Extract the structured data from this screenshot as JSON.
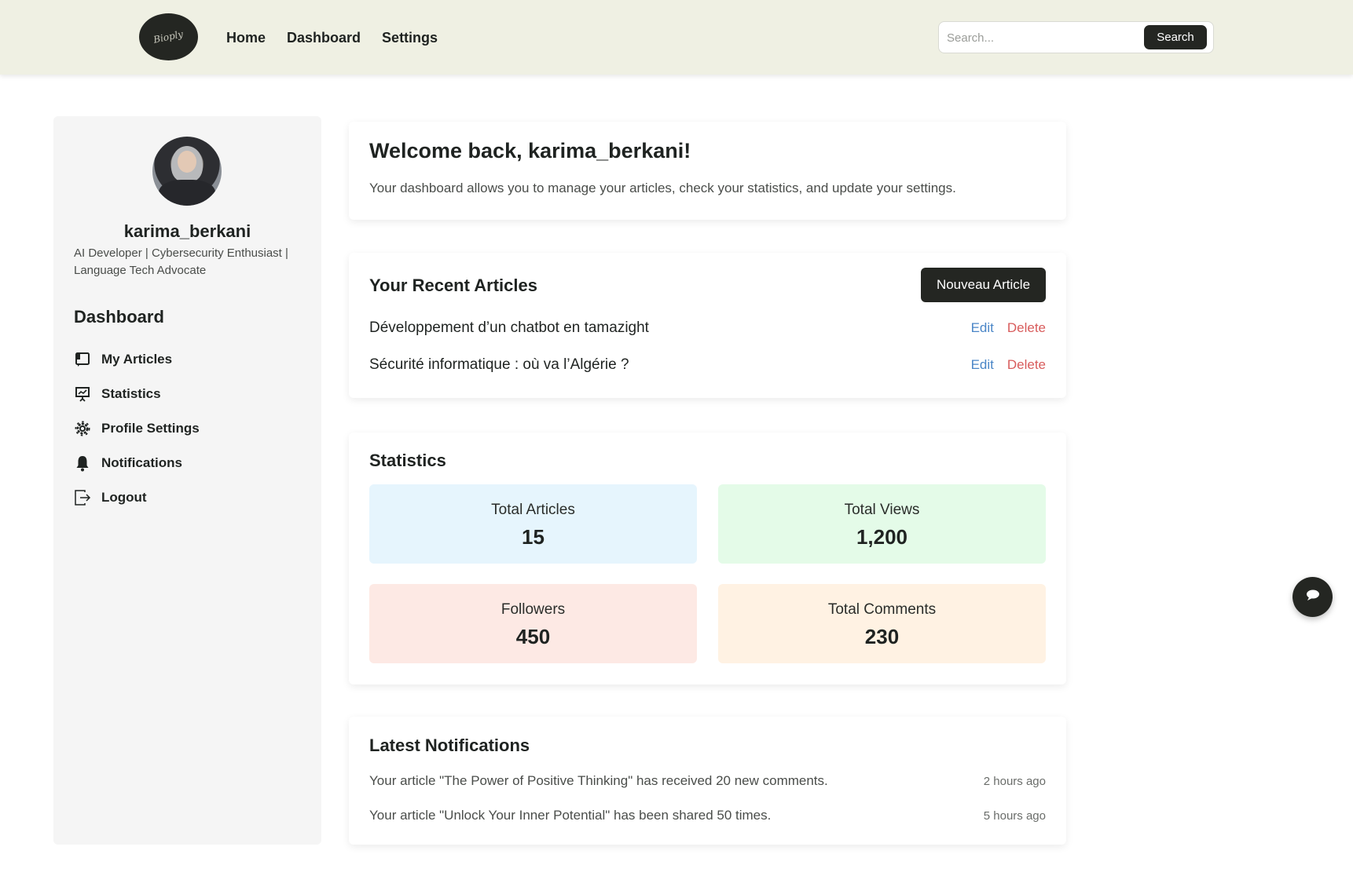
{
  "header": {
    "logo_text": "Bioply",
    "nav": [
      {
        "label": "Home"
      },
      {
        "label": "Dashboard"
      },
      {
        "label": "Settings"
      }
    ],
    "search": {
      "placeholder": "Search...",
      "button_label": "Search"
    }
  },
  "sidebar": {
    "username": "karima_berkani",
    "bio": "AI Developer | Cybersecurity Enthusiast | Language Tech Advocate",
    "heading": "Dashboard",
    "menu": [
      {
        "label": "My Articles",
        "icon": "articles-icon"
      },
      {
        "label": "Statistics",
        "icon": "presentation-icon"
      },
      {
        "label": "Profile Settings",
        "icon": "gear-icon"
      },
      {
        "label": "Notifications",
        "icon": "bell-icon"
      },
      {
        "label": "Logout",
        "icon": "logout-icon"
      }
    ]
  },
  "welcome": {
    "title": "Welcome back, karima_berkani!",
    "text": "Your dashboard allows you to manage your articles, check your statistics, and update your settings."
  },
  "articles": {
    "title": "Your Recent Articles",
    "new_button": "Nouveau Article",
    "edit_label": "Edit",
    "delete_label": "Delete",
    "items": [
      {
        "title": "Développement d’un chatbot en tamazight"
      },
      {
        "title": "Sécurité informatique : où va l’Algérie ?"
      }
    ]
  },
  "statistics": {
    "title": "Statistics",
    "items": [
      {
        "label": "Total Articles",
        "value": "15",
        "color": "#e6f5fd"
      },
      {
        "label": "Total Views",
        "value": "1,200",
        "color": "#e4fbe8"
      },
      {
        "label": "Followers",
        "value": "450",
        "color": "#fde9e4"
      },
      {
        "label": "Total Comments",
        "value": "230",
        "color": "#fff2e3"
      }
    ]
  },
  "notifications": {
    "title": "Latest Notifications",
    "items": [
      {
        "message": "Your article \"The Power of Positive Thinking\" has received 20 new comments.",
        "time": "2 hours ago"
      },
      {
        "message": "Your article \"Unlock Your Inner Potential\" has been shared 50 times.",
        "time": "5 hours ago"
      }
    ]
  },
  "colors": {
    "accent_dark": "#242622",
    "header_bg": "#eff0e3",
    "edit": "#4a86c7",
    "delete": "#d85c5c"
  }
}
